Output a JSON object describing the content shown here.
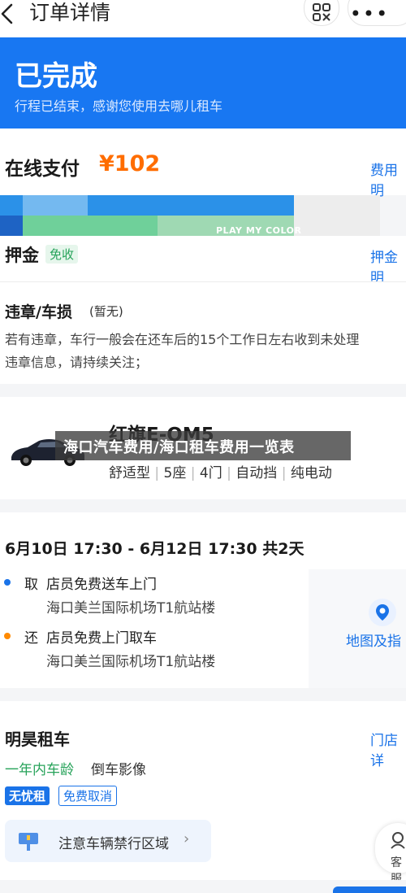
{
  "header": {
    "title": "订单详情",
    "back_icon": "chevron-left-icon",
    "scan_icon": "qr-scan-icon",
    "more_icon": "more-dots-icon"
  },
  "status": {
    "title": "已完成",
    "subtitle": "行程已结束，感谢您使用去哪儿租车",
    "bg_color": "#1877f2"
  },
  "payment": {
    "label": "在线支付",
    "amount": "¥102",
    "fee_link": "费用明",
    "amount_color": "#ff6d00"
  },
  "ad": {
    "text": "PLAY MY COLOR"
  },
  "deposit": {
    "label": "押金",
    "badge": "免收",
    "link": "押金明"
  },
  "violation": {
    "title": "违章/车损",
    "status": "(暂无)",
    "desc_line1": "若有违章，车行一般会在还车后的15个工作日左右收到未处理",
    "desc_line2": "违章信息，请持续关注；"
  },
  "car": {
    "name": "红旗E-QM5",
    "specs": [
      "舒适型",
      "5座",
      "4门",
      "自动挡",
      "纯电动"
    ],
    "banner": "海口汽车费用/海口租车费用一览表"
  },
  "trip": {
    "period": "6月10日 17:30 - 6月12日 17:30  共2天",
    "pickup": {
      "mode": "取",
      "service": "店员免费送车上门",
      "location": "海口美兰国际机场T1航站楼",
      "dot_color": "#1a73e8"
    },
    "return": {
      "mode": "还",
      "service": "店员免费上门取车",
      "location": "海口美兰国际机场T1航站楼",
      "dot_color": "#ff8a00"
    },
    "map_link": "地图及指",
    "map_icon": "map-pin-icon"
  },
  "store": {
    "name": "明昊租车",
    "store_link": "门店详",
    "feature1": "一年内车龄",
    "feature2": "倒车影像",
    "tag1": "无忧租",
    "tag2": "免费取消",
    "notice": "注意车辆禁行区域",
    "notice_icon": "notice-flag-icon",
    "service_label": "客服",
    "service_icon": "customer-service-icon"
  }
}
